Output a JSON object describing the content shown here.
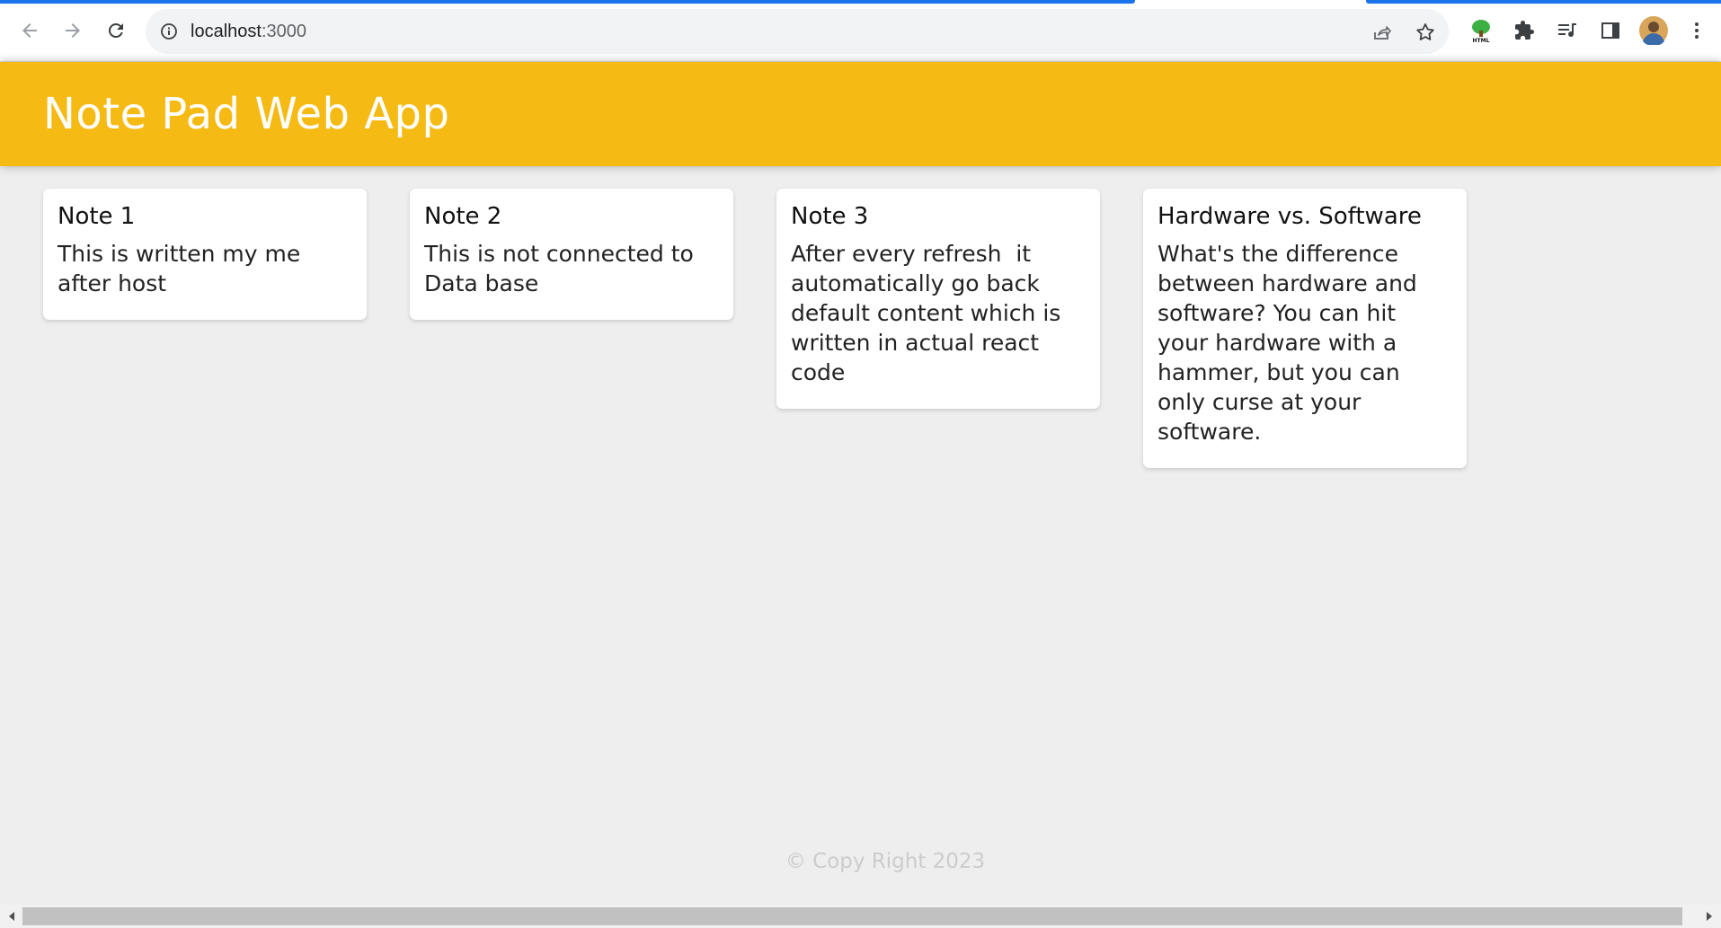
{
  "browser": {
    "url_host": "localhost",
    "url_port": ":3000",
    "extension_badge": "HTML",
    "icons": {
      "back": "arrow-left-icon",
      "forward": "arrow-right-icon",
      "reload": "reload-icon",
      "info": "info-icon",
      "share": "share-icon",
      "bookmark": "star-icon",
      "extension": "html-tree-icon",
      "extensions": "puzzle-icon",
      "media": "playlist-icon",
      "side_panel": "side-panel-icon",
      "profile": "avatar",
      "menu": "kebab-menu-icon"
    }
  },
  "app": {
    "title": "Note Pad Web App",
    "header_color": "#f5ba13",
    "notes": [
      {
        "title": "Note 1",
        "content": "This is written my me after host"
      },
      {
        "title": "Note 2",
        "content": "This is not connected to Data base"
      },
      {
        "title": "Note 3",
        "content": "After every refresh  it automatically go back default content which is written in actual react code"
      },
      {
        "title": "Hardware vs. Software",
        "content": "What's the difference between hardware and software? You can hit your hardware with a hammer, but you can only curse at your software."
      }
    ],
    "footer": "© Copy Right 2023"
  }
}
